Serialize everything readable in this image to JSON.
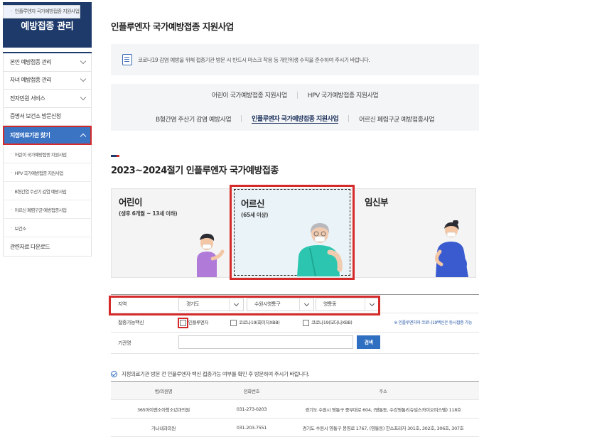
{
  "sidebar": {
    "title": "예방접종 관리",
    "items": [
      {
        "label": "본인 예방접종 관리"
      },
      {
        "label": "자녀 예방접종 관리"
      },
      {
        "label": "전자민원 서비스"
      },
      {
        "label": "증명서 보건소 방문신청"
      }
    ],
    "active": {
      "label": "지정의료기관 찾기"
    },
    "subitems": [
      {
        "label": "어린이 국가예방접종 지원사업"
      },
      {
        "label": "HPV 국가예방접종 지원사업"
      },
      {
        "label": "B형간염 주산기 감염 예방사업"
      },
      {
        "label": "인플루엔자 국가예방접종 지원사업"
      },
      {
        "label": "어르신 폐렴구균 예방접종사업"
      },
      {
        "label": "보건소"
      }
    ],
    "last": {
      "label": "관련자료 다운로드"
    }
  },
  "page": {
    "title": "인플루엔자 국가예방접종 지원사업",
    "notice": "코로나19 감염 예방을 위해 접종기관 방문 시 반드시 마스크 착용 등 개인위생 수칙을 준수하여 주시기 바랍니다."
  },
  "tabs": {
    "row1": [
      "어린이 국가예방접종 지원사업",
      "HPV 국가예방접종 지원사업"
    ],
    "row2": [
      "B형간염 주산기 감염 예방사업",
      "인플루엔자 국가예방접종 지원사업",
      "어르신 폐렴구균 예방접종사업"
    ]
  },
  "section": {
    "title": "2023~2024절기 인플루엔자 국가예방접종"
  },
  "cards": [
    {
      "label": "어린이",
      "sub": "(생후 6개월 ~ 13세 이하)"
    },
    {
      "label": "어르신",
      "sub": "(65세 이상)"
    },
    {
      "label": "임신부",
      "sub": ""
    }
  ],
  "filter": {
    "region_label": "지역",
    "province": "경기도",
    "city": "수원시영통구",
    "dong": "영통동",
    "vaccine_label": "접종가능백신",
    "vaccines": [
      "인플루엔자",
      "코로나19(화이자XBB)",
      "코로나19(모더나XBB)"
    ],
    "vaccine_note": "※ 인플루엔자와 코로나19백신은 동시접종 가능",
    "org_label": "기관명",
    "search_button": "검색"
  },
  "info": "지정의료기관 방문 전 인플루엔자 백신 접종가능 여부를 확인 후 방문하여 주시기 바랍니다.",
  "table": {
    "headers": [
      "병/의원명",
      "전화번호",
      "주소"
    ],
    "rows": [
      [
        "365아이앤소아청소년과의원",
        "031-273-0203",
        "경기도 수원시 영통구 중부대로 604, (영통동, 수강영통리슈빌스카이오피스텔) 118호"
      ],
      [
        "가나내과의원",
        "031-203-7551",
        "경기도 수원시 영통구 봉영로 1767, (영통동) 한스프라자 301호, 302호, 306호, 307호"
      ]
    ]
  }
}
